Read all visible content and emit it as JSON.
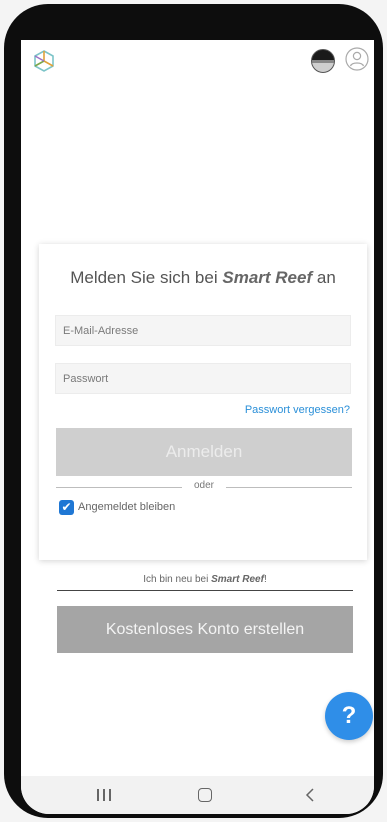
{
  "login": {
    "title_prefix": "Melden Sie sich bei",
    "brand": "Smart Reef",
    "title_suffix": "an",
    "email_placeholder": "E-Mail-Adresse",
    "password_placeholder": "Passwort",
    "forgot_password": "Passwort vergessen?",
    "login_button": "Anmelden",
    "divider_text": "oder",
    "remember_me": "Angemeldet bleiben",
    "remember_checked": true
  },
  "signup": {
    "prompt_prefix": "Ich bin neu bei",
    "prompt_brand": "Smart Reef",
    "prompt_suffix": "!",
    "create_button": "Kostenloses Konto erstellen"
  },
  "help_button": "?",
  "icons": {
    "logo": "cube-logo-icon",
    "theme": "theme-toggle-icon",
    "profile": "profile-icon",
    "help": "help-icon",
    "checkbox": "checkmark-icon",
    "nav": [
      "recent-apps-icon",
      "home-icon",
      "back-icon"
    ]
  },
  "colors": {
    "accent": "#2f8ee8",
    "link": "#2a8fd8",
    "checkbox": "#1f77d4",
    "login_button_bg": "#cfcfcf",
    "create_button_bg": "#a5a5a5"
  }
}
